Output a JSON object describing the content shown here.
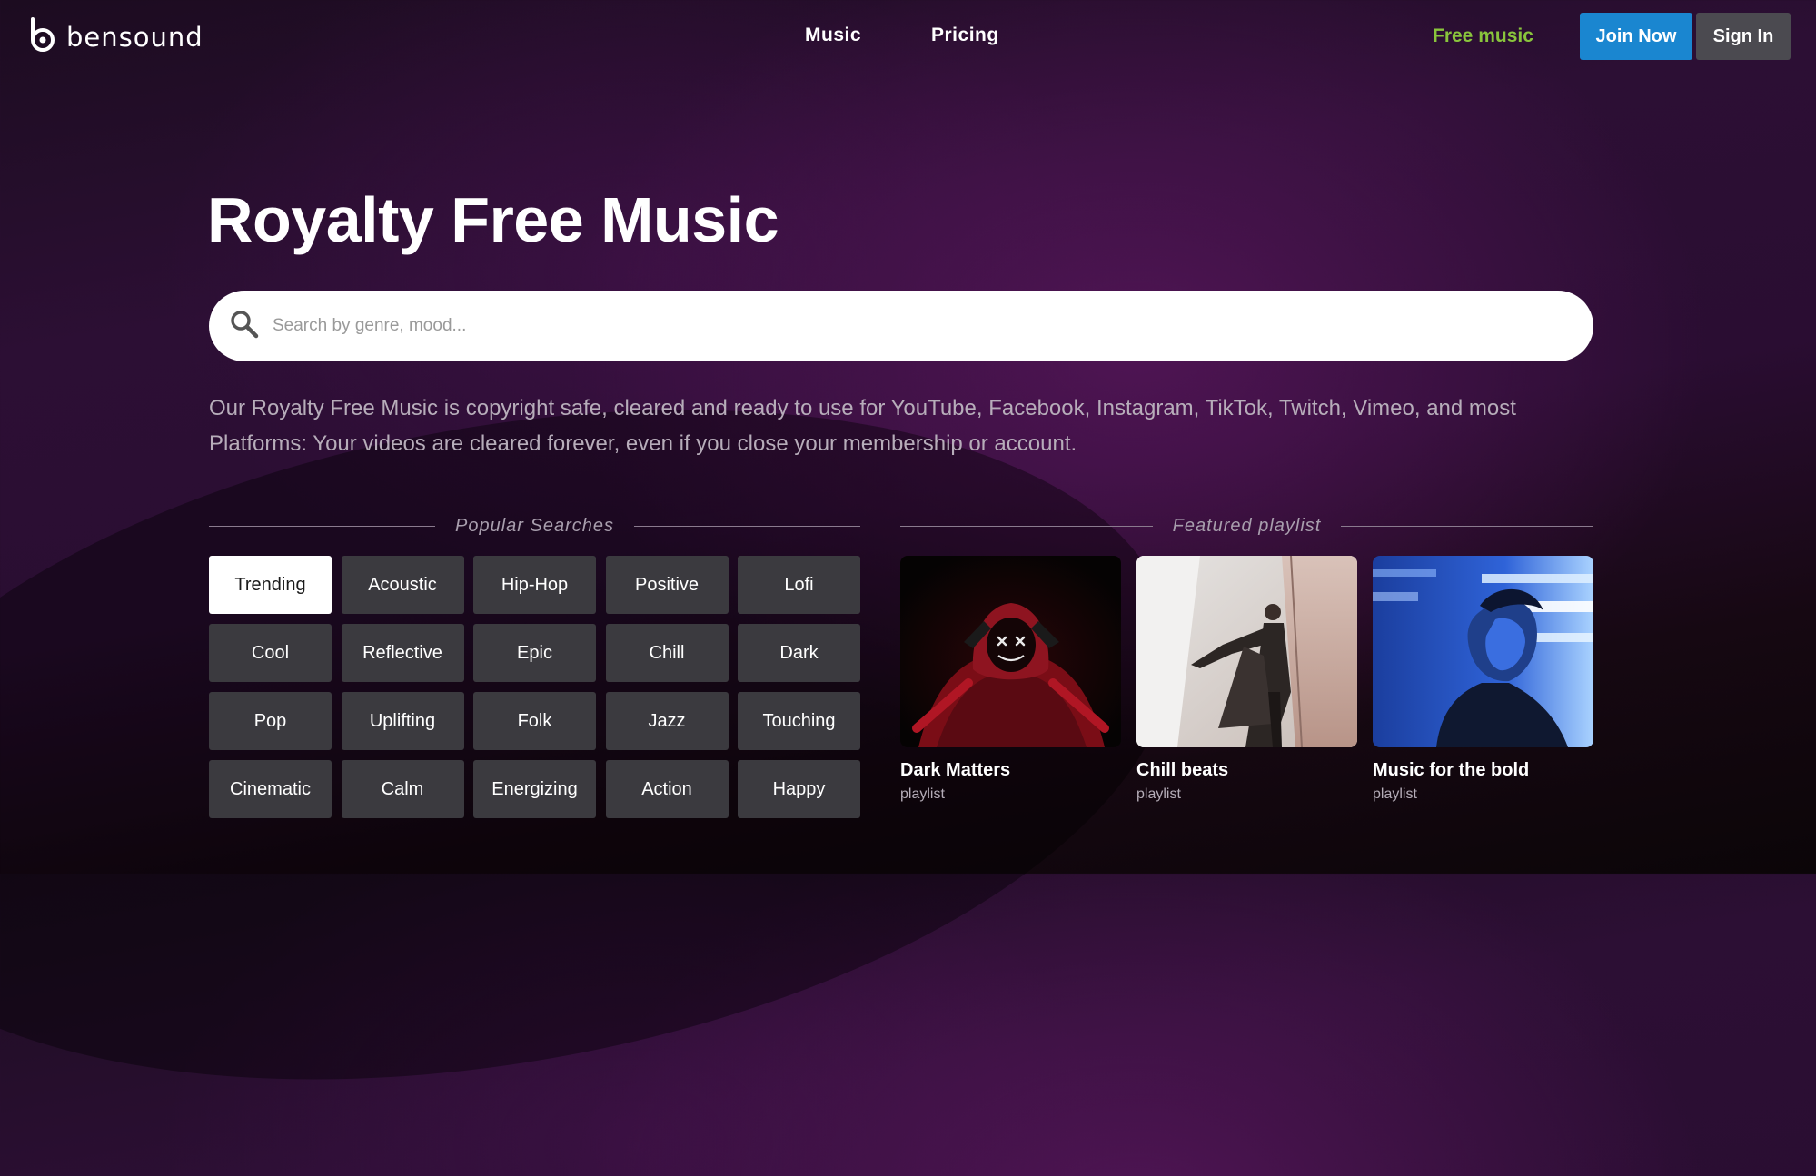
{
  "header": {
    "logo_text": "bensound",
    "nav": [
      "Music",
      "Pricing"
    ],
    "free_music": "Free music",
    "join_label": "Join Now",
    "sign_in_label": "Sign In"
  },
  "hero": {
    "title": "Royalty Free Music",
    "search_placeholder": "Search by genre, mood...",
    "description": "Our Royalty Free Music is copyright safe, cleared and ready to use for YouTube, Facebook, Instagram, TikTok, Twitch, Vimeo, and most Platforms: Your videos are cleared forever, even if you close your membership or account."
  },
  "popular": {
    "heading": "Popular Searches",
    "tags": [
      "Trending",
      "Acoustic",
      "Hip-Hop",
      "Positive",
      "Lofi",
      "Cool",
      "Reflective",
      "Epic",
      "Chill",
      "Dark",
      "Pop",
      "Uplifting",
      "Folk",
      "Jazz",
      "Touching",
      "Cinematic",
      "Calm",
      "Energizing",
      "Action",
      "Happy"
    ],
    "active_tag": "Trending"
  },
  "featured": {
    "heading": "Featured playlist",
    "playlists": [
      {
        "name": "Dark Matters",
        "type": "playlist"
      },
      {
        "name": "Chill beats",
        "type": "playlist"
      },
      {
        "name": "Music for the bold",
        "type": "playlist"
      }
    ]
  },
  "colors": {
    "accent_green": "#89c43c",
    "join_blue": "#1a86d0",
    "sign_in_gray": "#4b4a50",
    "tag_gray": "#3b3a3f"
  }
}
